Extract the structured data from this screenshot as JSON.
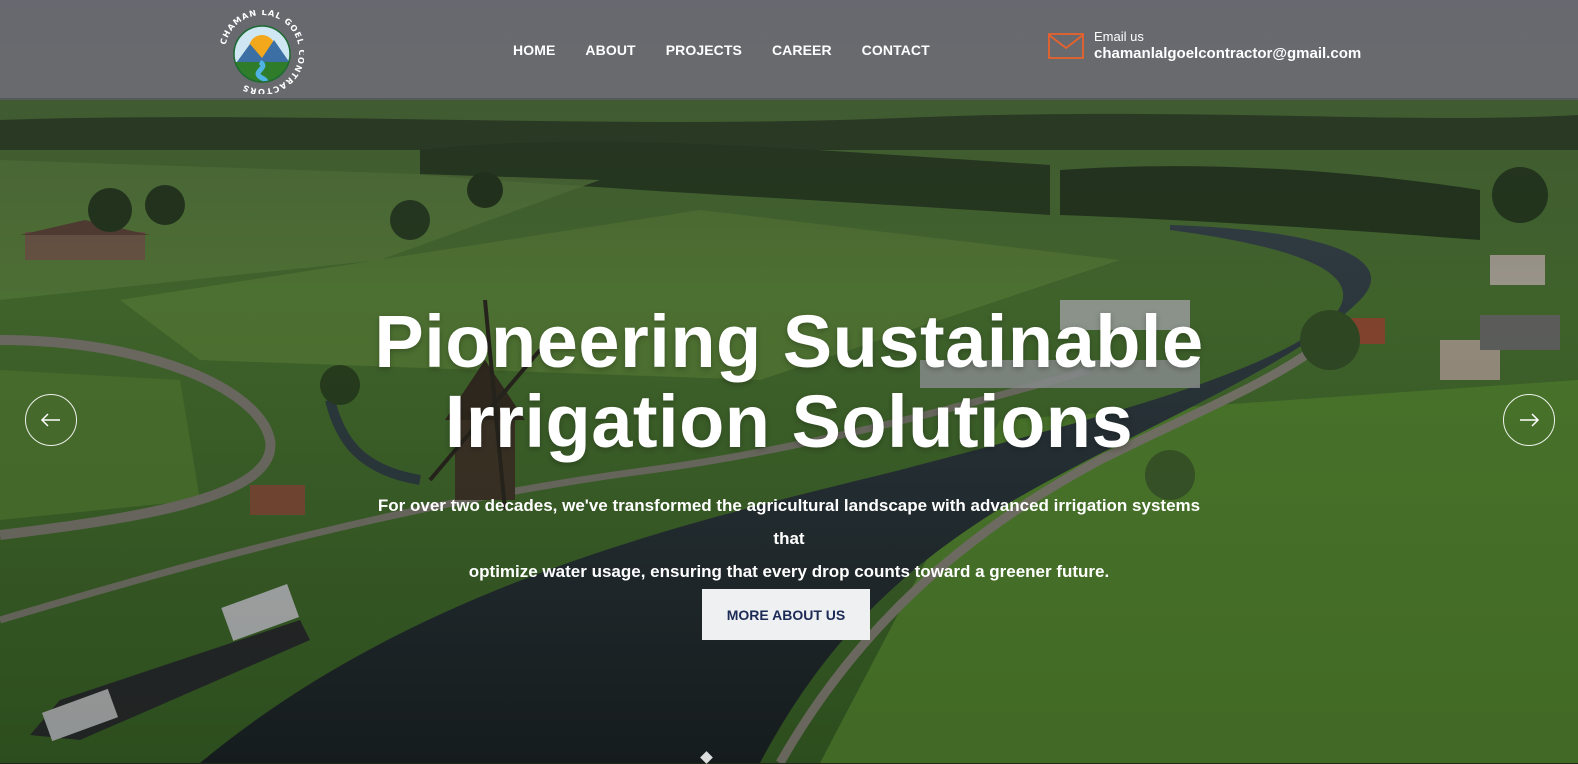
{
  "brand": {
    "logo_icon": "company-logo-sun-mountains-river",
    "logo_text": "CHAMAN LAL GOEL CONTRACTORS",
    "colors": {
      "header_bg": "#787880",
      "accent": "#e8622c",
      "button_bg": "#eef0f2",
      "button_text": "#1c2a55"
    }
  },
  "nav": {
    "items": [
      {
        "label": "HOME"
      },
      {
        "label": "ABOUT"
      },
      {
        "label": "PROJECTS"
      },
      {
        "label": "CAREER"
      },
      {
        "label": "CONTACT"
      }
    ]
  },
  "contact": {
    "icon": "envelope-icon",
    "label": "Email us",
    "email": "chamanlalgoelcontractor@gmail.com"
  },
  "hero": {
    "title_line1": "Pioneering Sustainable",
    "title_line2": "Irrigation Solutions",
    "subtitle_line1": "For over two decades, we've transformed the agricultural landscape with advanced irrigation systems that",
    "subtitle_line2": "optimize water usage, ensuring that every drop counts toward a greener future.",
    "button_label": "MORE ABOUT US",
    "prev_icon": "arrow-left-icon",
    "next_icon": "arrow-right-icon"
  }
}
